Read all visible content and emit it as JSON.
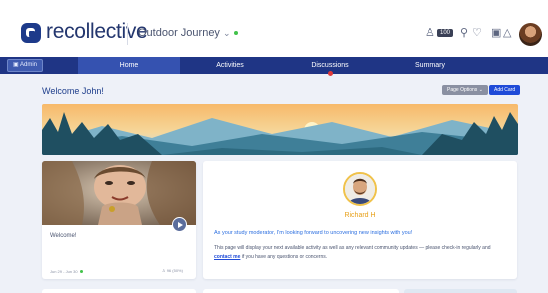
{
  "header": {
    "brand": "recollective",
    "project": "Outdoor Journey",
    "badge_count": "100"
  },
  "nav": {
    "admin_label": "Admin",
    "items": [
      {
        "label": "Home",
        "active": true
      },
      {
        "label": "Activities",
        "active": false
      },
      {
        "label": "Discussions",
        "active": false
      },
      {
        "label": "Summary",
        "active": false
      }
    ]
  },
  "main": {
    "welcome": "Welcome John!",
    "page_options": "Page Options",
    "add_card": "Add Card"
  },
  "video_card": {
    "title": "Welcome!",
    "date_range": "Jun 29 - Jun 30",
    "count": "96 (50%)"
  },
  "moderator_card": {
    "name": "Richard H",
    "heading": "As your study moderator, I'm looking forward to uncovering new insights with you!",
    "body_before": "This page will display your next available activity as well as any relevant community updates — please check-in regularly and ",
    "link": "contact me",
    "body_after": " if you have any questions or concerns."
  },
  "colors": {
    "nav": "#1f3585",
    "accent": "#1f4bd8",
    "moderator_name": "#e8a11a",
    "status_green": "#42c24a"
  }
}
